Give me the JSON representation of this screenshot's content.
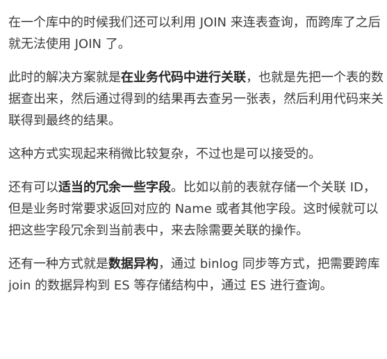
{
  "article": {
    "paragraphs": [
      {
        "segments": [
          {
            "text": "在一个库中的时候我们还可以利用 JOIN 来连表查询，而跨库了之后就无法使用 JOIN 了。",
            "bold": false
          }
        ]
      },
      {
        "segments": [
          {
            "text": "此时的解决方案就是",
            "bold": false
          },
          {
            "text": "在业务代码中进行关联",
            "bold": true
          },
          {
            "text": "，也就是先把一个表的数据查出来，然后通过得到的结果再去查另一张表，然后利用代码来关联得到最终的结果。",
            "bold": false
          }
        ]
      },
      {
        "segments": [
          {
            "text": "这种方式实现起来稍微比较复杂，不过也是可以接受的。",
            "bold": false
          }
        ]
      },
      {
        "segments": [
          {
            "text": "还有可以",
            "bold": false
          },
          {
            "text": "适当的冗余一些字段",
            "bold": true
          },
          {
            "text": "。比如以前的表就存储一个关联 ID，但是业务时常要求返回对应的 Name 或者其他字段。这时候就可以把这些字段冗余到当前表中，来去除需要关联的操作。",
            "bold": false
          }
        ]
      },
      {
        "segments": [
          {
            "text": "还有一种方式就是",
            "bold": false
          },
          {
            "text": "数据异构",
            "bold": true
          },
          {
            "text": "，通过 binlog 同步等方式，把需要跨库 join 的数据异构到 ES 等存储结构中，通过 ES 进行查询。",
            "bold": false
          }
        ]
      }
    ]
  }
}
